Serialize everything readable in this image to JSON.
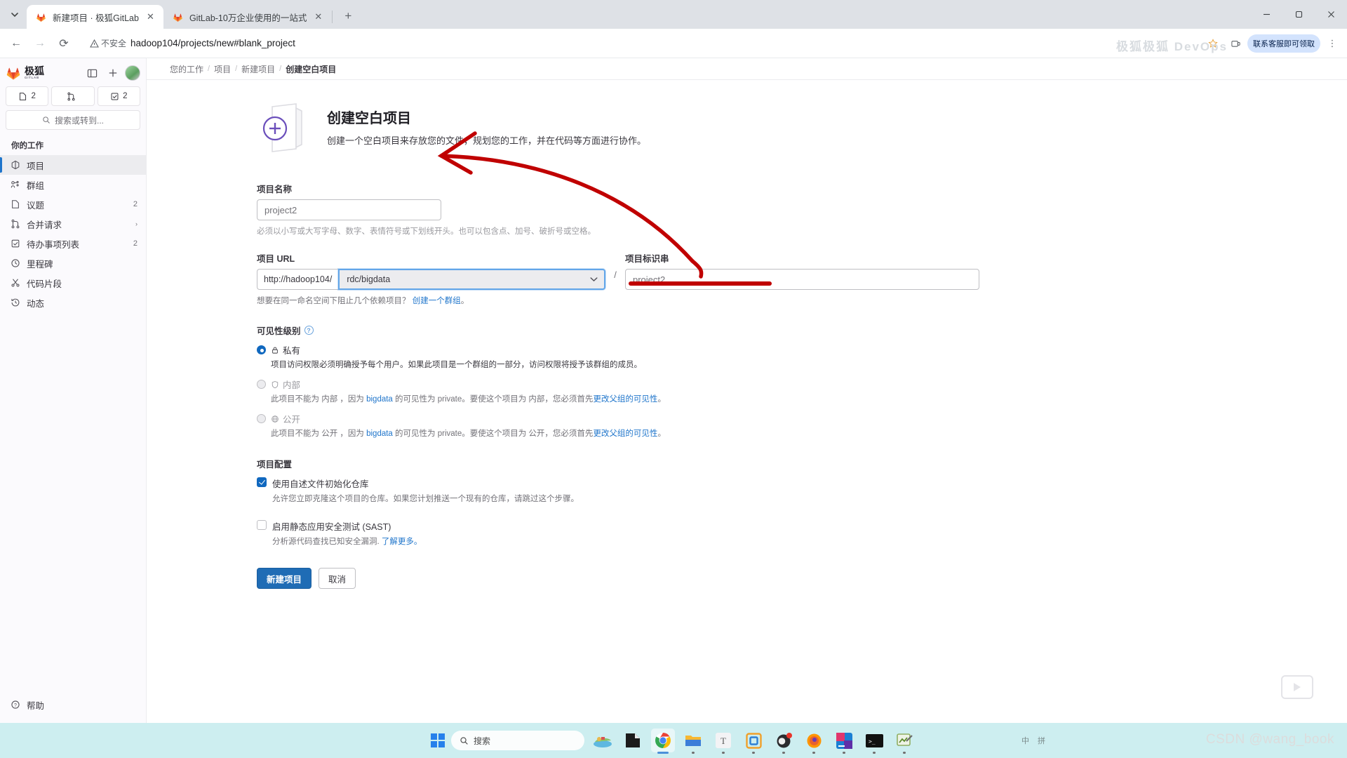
{
  "browser": {
    "tabs": [
      {
        "title": "新建项目 · 极狐GitLab",
        "favicon": "gitlab-fox-icon",
        "active": true
      },
      {
        "title": "GitLab-10万企业使用的一站式",
        "favicon": "gitlab-fox-icon",
        "active": false
      }
    ],
    "newtab_label": "+",
    "nav": {
      "back": "←",
      "forward": "→",
      "reload": "⟳"
    },
    "omnibox": {
      "security_label": "不安全",
      "url": "hadoop104/projects/new#blank_project"
    },
    "profile_pill": "联系客服即可领取",
    "ghost_text": "极狐极狐 DevOps",
    "window_controls": {
      "minimize": "—",
      "maximize": "□",
      "close": "✕"
    }
  },
  "sidebar": {
    "brand": {
      "name": "极狐",
      "sub": "GITLAB"
    },
    "toggle_icon": "sidebar-toggle-icon",
    "create_icon": "plus-icon",
    "counters": [
      {
        "icon": "issues-icon",
        "value": "2"
      },
      {
        "icon": "merge-request-icon",
        "value": ""
      },
      {
        "icon": "todo-icon",
        "value": "2"
      }
    ],
    "search_placeholder": "搜索或转到...",
    "section_title": "你的工作",
    "items": [
      {
        "label": "项目",
        "icon": "project-icon",
        "badge": "",
        "active": true,
        "chevron": false
      },
      {
        "label": "群组",
        "icon": "group-icon",
        "badge": "",
        "active": false,
        "chevron": false
      },
      {
        "label": "议题",
        "icon": "issues-icon",
        "badge": "2",
        "active": false,
        "chevron": false
      },
      {
        "label": "合并请求",
        "icon": "merge-request-icon",
        "badge": "",
        "active": false,
        "chevron": true
      },
      {
        "label": "待办事项列表",
        "icon": "todo-icon",
        "badge": "2",
        "active": false,
        "chevron": false
      },
      {
        "label": "里程碑",
        "icon": "clock-icon",
        "badge": "",
        "active": false,
        "chevron": false
      },
      {
        "label": "代码片段",
        "icon": "scissors-icon",
        "badge": "",
        "active": false,
        "chevron": false
      },
      {
        "label": "动态",
        "icon": "history-icon",
        "badge": "",
        "active": false,
        "chevron": false
      }
    ],
    "help": {
      "label": "帮助",
      "icon": "question-circle-icon"
    }
  },
  "breadcrumb": {
    "items": [
      "您的工作",
      "项目",
      "新建项目",
      "创建空白项目"
    ],
    "separator": "/"
  },
  "form": {
    "hero": {
      "icon": "new-project-folder-plus-icon",
      "title": "创建空白项目",
      "description": "创建一个空白项目来存放您的文件，规划您的工作，并在代码等方面进行协作。"
    },
    "project_name": {
      "label": "项目名称",
      "value": "project2",
      "help": "必须以小写或大写字母、数字、表情符号或下划线开头。也可以包含点、加号、破折号或空格。"
    },
    "project_url": {
      "label": "项目 URL",
      "prefix": "http://hadoop104/",
      "namespace": "rdc/bigdata",
      "dropdown_icon": "chevron-down-icon",
      "help_prefix": "想要在同一命名空间下阻止几个依赖项目？",
      "help_link": "创建一个群组",
      "help_suffix": "。"
    },
    "project_slug": {
      "label": "项目标识串",
      "value": "project2",
      "separator": "/"
    },
    "visibility": {
      "title": "可见性级别",
      "help_icon": "question-circle-icon",
      "options": [
        {
          "label": "私有",
          "icon": "lock-icon",
          "selected": true,
          "disabled": false,
          "desc": "项目访问权限必须明确授予每个用户。如果此项目是一个群组的一部分，访问权限将授予该群组的成员。",
          "desc_parts": null
        },
        {
          "label": "内部",
          "icon": "shield-icon",
          "selected": false,
          "disabled": true,
          "desc": "",
          "desc_parts": {
            "p1": "此项目不能为 内部 ，因为 ",
            "code": "bigdata",
            "p2": " 的可见性为 private。要使这个项目为 内部，您必须首先",
            "link": "更改父组的可见性",
            "p3": "。"
          }
        },
        {
          "label": "公开",
          "icon": "globe-icon",
          "selected": false,
          "disabled": true,
          "desc": "",
          "desc_parts": {
            "p1": "此项目不能为 公开 ，因为 ",
            "code": "bigdata",
            "p2": " 的可见性为 private。要使这个项目为 公开，您必须首先",
            "link": "更改父组的可见性",
            "p3": "。"
          }
        }
      ]
    },
    "configuration": {
      "title": "项目配置",
      "options": [
        {
          "label": "使用自述文件初始化仓库",
          "checked": true,
          "desc": "允许您立即克隆这个项目的仓库。如果您计划推送一个现有的仓库，请跳过这个步骤。",
          "link": ""
        },
        {
          "label": "启用静态应用安全测试 (SAST)",
          "checked": false,
          "desc": "分析源代码查找已知安全漏洞. ",
          "link": "了解更多。"
        }
      ]
    },
    "buttons": {
      "submit": "新建项目",
      "cancel": "取消"
    }
  },
  "taskbar": {
    "start_icon": "windows-logo-icon",
    "search_placeholder": "搜索",
    "search_icon": "search-icon",
    "apps": [
      {
        "name": "weather-widget-icon",
        "dot": false,
        "active": false
      },
      {
        "name": "dark-app-icon",
        "dot": false,
        "active": false
      },
      {
        "name": "chrome-icon",
        "dot": true,
        "wide": true,
        "active": true
      },
      {
        "name": "file-explorer-icon",
        "dot": true,
        "active": false
      },
      {
        "name": "typora-icon",
        "dot": true,
        "active": false
      },
      {
        "name": "vmware-icon",
        "dot": true,
        "active": false
      },
      {
        "name": "obs-icon",
        "dot": true,
        "active": false,
        "badge": true
      },
      {
        "name": "firefox-icon",
        "dot": true,
        "active": false
      },
      {
        "name": "jetbrains-icon",
        "dot": true,
        "active": false
      },
      {
        "name": "terminal-icon",
        "dot": true,
        "active": false
      },
      {
        "name": "snipaste-icon",
        "dot": true,
        "active": false
      }
    ],
    "watermark": "CSDN @wang_book",
    "tray": [
      "中",
      "拼"
    ]
  },
  "colors": {
    "accent_blue": "#1f75cb",
    "button_blue": "#1f6cb5",
    "annotation_red": "#c00000",
    "purple": "#6b4fbb",
    "taskbar": "#cdeef0"
  }
}
